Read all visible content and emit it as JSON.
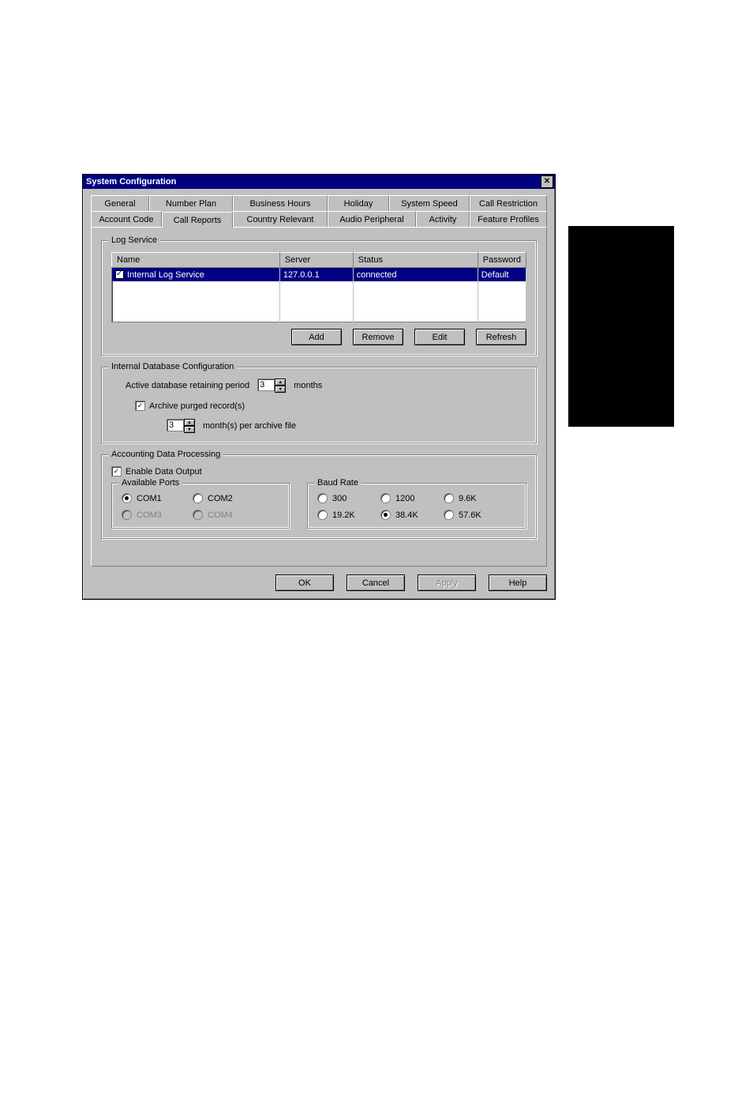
{
  "title": "System Configuration",
  "tabs": {
    "row1": [
      "General",
      "Number Plan",
      "Business Hours",
      "Holiday",
      "System Speed",
      "Call Restriction"
    ],
    "row2": [
      "Account Code",
      "Call Reports",
      "Country Relevant",
      "Audio Peripheral",
      "Activity",
      "Feature Profiles"
    ],
    "active": "Call Reports"
  },
  "log_service": {
    "legend": "Log Service",
    "columns": [
      "Name",
      "Server",
      "Status",
      "Password"
    ],
    "rows": [
      {
        "checked": true,
        "name": "Internal Log Service",
        "server": "127.0.0.1",
        "status": "connected",
        "password": "Default"
      }
    ],
    "buttons": {
      "add": "Add",
      "remove": "Remove",
      "edit": "Edit",
      "refresh": "Refresh"
    }
  },
  "idb": {
    "legend": "Internal Database Configuration",
    "retain_label": "Active database retaining period",
    "retain_value": "3",
    "retain_unit": "months",
    "archive_checked": true,
    "archive_label": "Archive purged record(s)",
    "per_file_value": "3",
    "per_file_unit": "month(s) per archive file"
  },
  "adp": {
    "legend": "Accounting Data Processing",
    "enable_checked": true,
    "enable_label": "Enable Data Output",
    "ports_legend": "Available Ports",
    "ports": [
      {
        "label": "COM1",
        "selected": true,
        "disabled": false
      },
      {
        "label": "COM2",
        "selected": false,
        "disabled": false
      },
      {
        "label": "COM3",
        "selected": false,
        "disabled": true
      },
      {
        "label": "COM4",
        "selected": false,
        "disabled": true
      }
    ],
    "baud_legend": "Baud Rate",
    "bauds": [
      {
        "label": "300",
        "selected": false
      },
      {
        "label": "1200",
        "selected": false
      },
      {
        "label": "9.6K",
        "selected": false
      },
      {
        "label": "19.2K",
        "selected": false
      },
      {
        "label": "38.4K",
        "selected": true
      },
      {
        "label": "57.6K",
        "selected": false
      }
    ]
  },
  "dialog": {
    "ok": "OK",
    "cancel": "Cancel",
    "apply": "Apply",
    "help": "Help"
  }
}
